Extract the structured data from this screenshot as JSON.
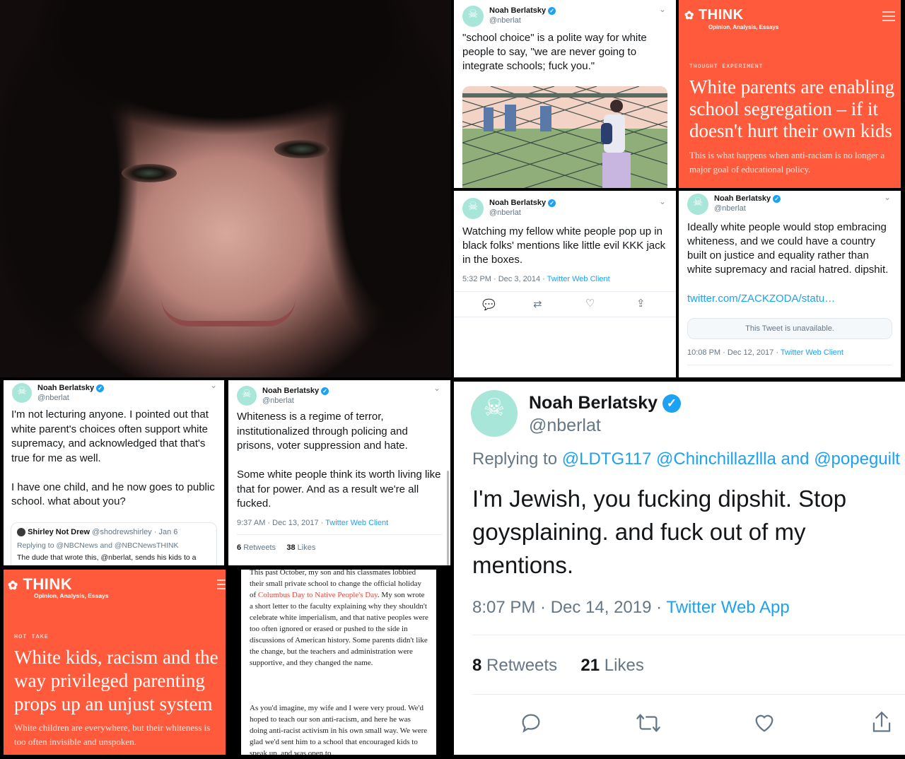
{
  "profile": {
    "name": "Noah Berlatsky",
    "handle": "@nberlat"
  },
  "tweet1": {
    "text": "\"school choice\" is a polite way for white people to say, \"we are never going to integrate schools; fuck you.\""
  },
  "think1": {
    "logo": "THINK",
    "subtitle": "Opinion, Analysis, Essays",
    "kicker": "THOUGHT EXPERIMENT",
    "title": "White parents are enabling school segregation – if it doesn't hurt their own kids",
    "dek": "This is what happens when anti-racism is no longer a major goal of educational policy."
  },
  "tweet2": {
    "text": "Watching my fellow white people pop up in black folks' mentions like little evil KKK jack in the boxes.",
    "time": "5:32 PM · Dec 3, 2014 · ",
    "client": "Twitter Web Client"
  },
  "tweet3": {
    "text": "Ideally white people would stop embracing whiteness, and we could have a country built on justice and equality rather than white supremacy and racial hatred. dipshit.",
    "link": "twitter.com/ZACKZODA/statu…",
    "unavailable": "This Tweet is unavailable.",
    "time": "10:08 PM · Dec 12, 2017 · ",
    "client": "Twitter Web Client"
  },
  "tweet4": {
    "text": "I'm not lecturing anyone. I pointed out that white parent's choices often support white supremacy, and acknowledged that that's true for me as well.\n\nI have one child, and he now goes to public school. what about you?",
    "quote_name": "Shirley Not Drew",
    "quote_handle": "@shodrewshirley · Jan 6",
    "quote_reply": "Replying to @NBCNews and @NBCNewsTHINK",
    "quote_text": "The dude that wrote this, @nberlat, sends his kids to a"
  },
  "tweet5": {
    "text": "Whiteness is a regime of terror, institutionalized through policing and prisons, voter suppression and hate.\n\nSome white people think its worth living like that for power. And as a result we're all fucked.",
    "time": "9:37 AM · Dec 13, 2017 · ",
    "client": "Twitter Web Client",
    "retweets_count": "6",
    "retweets_label": "Retweets",
    "likes_count": "38",
    "likes_label": "Likes"
  },
  "tweet6": {
    "replying_label": "Replying to ",
    "replying_to": "@LDTG117 @Chinchillazllla and @popeguilt",
    "text": "I'm Jewish, you fucking dipshit. Stop goysplaining. and fuck out of my mentions.",
    "time": "8:07 PM · Dec 14, 2019 · ",
    "client": "Twitter Web App",
    "retweets_count": "8",
    "retweets_label": "Retweets",
    "likes_count": "21",
    "likes_label": "Likes"
  },
  "think2": {
    "logo": "THINK",
    "subtitle": "Opinion, Analysis, Essays",
    "kicker": "HOT TAKE",
    "title": "White kids, racism and the way privileged parenting props up an unjust system",
    "dek": "White children are everywhere, but their whiteness is too often invisible and unspoken."
  },
  "article": {
    "p1_a": "This past October, my son and his classmates lobbied their small private school to change the official holiday of ",
    "p1_link": "Columbus Day to Native People's Day",
    "p1_b": ". My son wrote a short letter to the faculty explaining why they shouldn't celebrate white imperialism, and that native peoples were too often ignored or erased or pushed to the side in discussions of American history. Some parents didn't like the change, but the teachers and administration were supportive, and they changed the name.",
    "p2": "As you'd imagine, my wife and I were very proud. We'd hoped to teach our son anti-racism, and here he was doing anti-racist activism in his own small way. We were glad we'd sent him to a school that encouraged kids to speak up, and was open to"
  },
  "colors": {
    "think": "#ff5a3c",
    "twitter_blue": "#1da1f2",
    "verified": "#1da1f2",
    "avatar": "#a7e6d8"
  },
  "icons": [
    "reply-icon",
    "retweet-icon",
    "like-icon",
    "share-icon",
    "verified-icon",
    "chevron-down-icon",
    "nbc-peacock-icon",
    "menu-icon"
  ]
}
